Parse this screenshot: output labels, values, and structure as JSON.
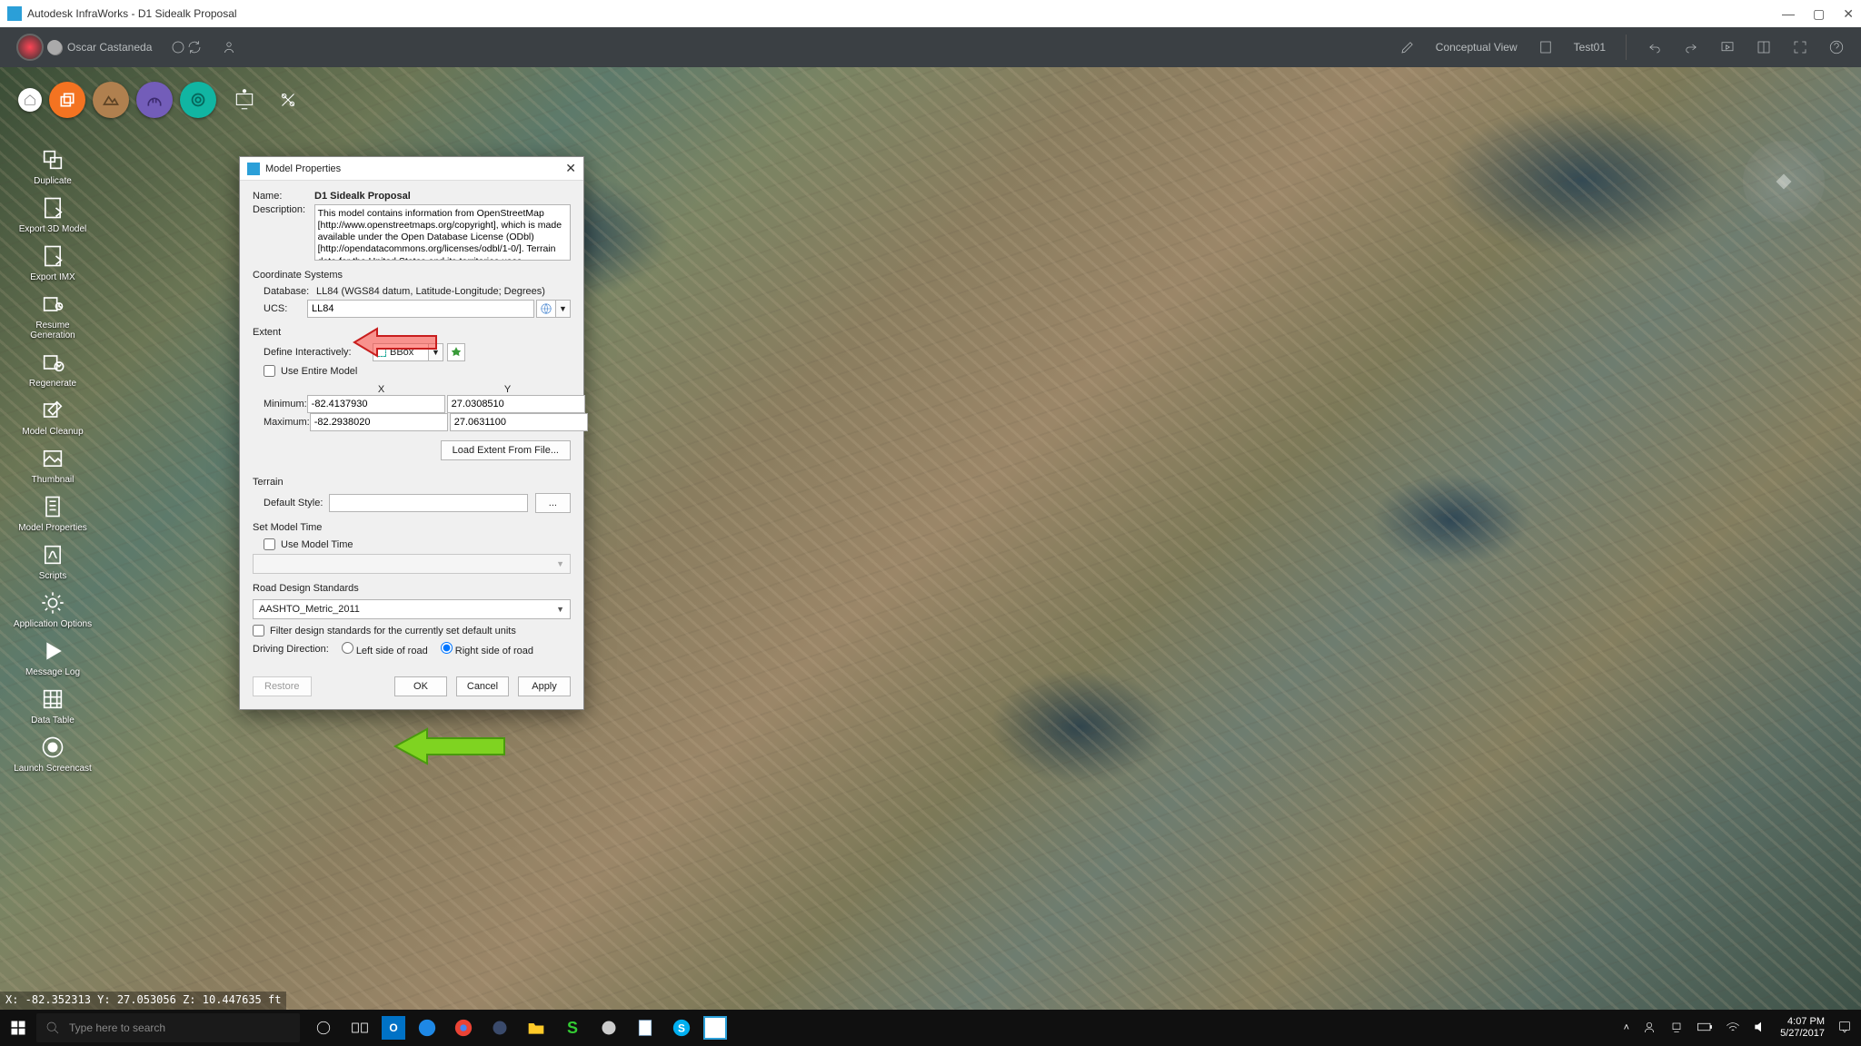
{
  "window": {
    "title": "Autodesk InfraWorks - D1 Sidealk Proposal"
  },
  "header": {
    "username": "Oscar Castaneda",
    "view_label": "Conceptual View",
    "proposal_label": "Test01"
  },
  "left_tools": [
    {
      "id": "duplicate",
      "label": "Duplicate"
    },
    {
      "id": "export-3d",
      "label": "Export 3D Model"
    },
    {
      "id": "export-imx",
      "label": "Export IMX"
    },
    {
      "id": "resume-gen",
      "label": "Resume Generation"
    },
    {
      "id": "regenerate",
      "label": "Regenerate"
    },
    {
      "id": "model-cleanup",
      "label": "Model Cleanup"
    },
    {
      "id": "thumbnail",
      "label": "Thumbnail"
    },
    {
      "id": "model-properties",
      "label": "Model Properties"
    },
    {
      "id": "scripts",
      "label": "Scripts"
    },
    {
      "id": "app-options",
      "label": "Application Options"
    },
    {
      "id": "message-log",
      "label": "Message Log"
    },
    {
      "id": "data-table",
      "label": "Data Table"
    },
    {
      "id": "launch-screencast",
      "label": "Launch Screencast"
    }
  ],
  "dialog": {
    "title": "Model Properties",
    "name_label": "Name:",
    "name_value": "D1 Sidealk Proposal",
    "description_label": "Description:",
    "description_value": "This model contains information from OpenStreetMap [http://www.openstreetmaps.org/copyright], which is made available under the Open Database License (ODbl) [http://opendatacommons.org/licenses/odbl/1-0/]. Terrain data for the United States and its territories uses",
    "coord_header": "Coordinate Systems",
    "database_label": "Database:",
    "database_value": "LL84 (WGS84 datum, Latitude-Longitude; Degrees)",
    "ucs_label": "UCS:",
    "ucs_value": "LL84",
    "extent_header": "Extent",
    "define_label": "Define Interactively:",
    "bbox_label": "BBox",
    "use_entire_label": "Use Entire Model",
    "col_x": "X",
    "col_y": "Y",
    "min_label": "Minimum:",
    "max_label": "Maximum:",
    "min_x": "-82.4137930",
    "min_y": "27.0308510",
    "max_x": "-82.2938020",
    "max_y": "27.0631100",
    "load_extent_btn": "Load Extent From File...",
    "terrain_header": "Terrain",
    "default_style_label": "Default Style:",
    "ellipsis": "...",
    "model_time_header": "Set Model Time",
    "use_model_time_label": "Use Model Time",
    "road_std_header": "Road Design Standards",
    "road_std_value": "AASHTO_Metric_2011",
    "filter_std_label": "Filter design standards for the currently set default units",
    "driving_dir_label": "Driving Direction:",
    "left_side": "Left side of road",
    "right_side": "Right side of road",
    "restore_btn": "Restore",
    "ok_btn": "OK",
    "cancel_btn": "Cancel",
    "apply_btn": "Apply"
  },
  "statusbar": {
    "coords": "X: -82.352313 Y: 27.053056 Z: 10.447635 ft"
  },
  "taskbar": {
    "search_placeholder": "Type here to search",
    "time": "4:07 PM",
    "date": "5/27/2017"
  }
}
